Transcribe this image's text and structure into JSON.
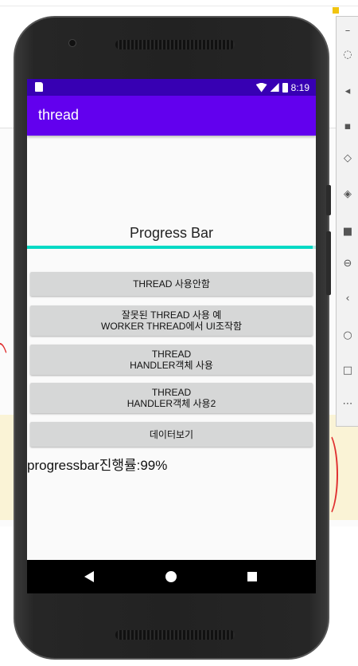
{
  "app": {
    "title": "thread",
    "status_time": "8:19"
  },
  "progress": {
    "label": "Progress Bar",
    "fraction": 0.99,
    "status_text": "progressbar진행률:99%"
  },
  "buttons": [
    {
      "line1": "THREAD 사용안함",
      "line2": ""
    },
    {
      "line1": "잘못된 THREAD 사용 예",
      "line2": "WORKER THREAD에서 UI조작함"
    },
    {
      "line1": "THREAD",
      "line2": "HANDLER객체 사용"
    },
    {
      "line1": "THREAD",
      "line2": "HANDLER객체 사용2"
    },
    {
      "line1": "데이터보기",
      "line2": ""
    }
  ],
  "icons": {
    "status": [
      "sd-card-icon",
      "wifi-icon",
      "signal-icon",
      "battery-icon"
    ],
    "nav": [
      "back-icon",
      "home-icon",
      "recent-apps-icon"
    ]
  },
  "colors": {
    "status_bar": "#3700b3",
    "app_bar": "#6200ee",
    "progress_fill": "#03dac5",
    "button": "#d6d7d7"
  }
}
